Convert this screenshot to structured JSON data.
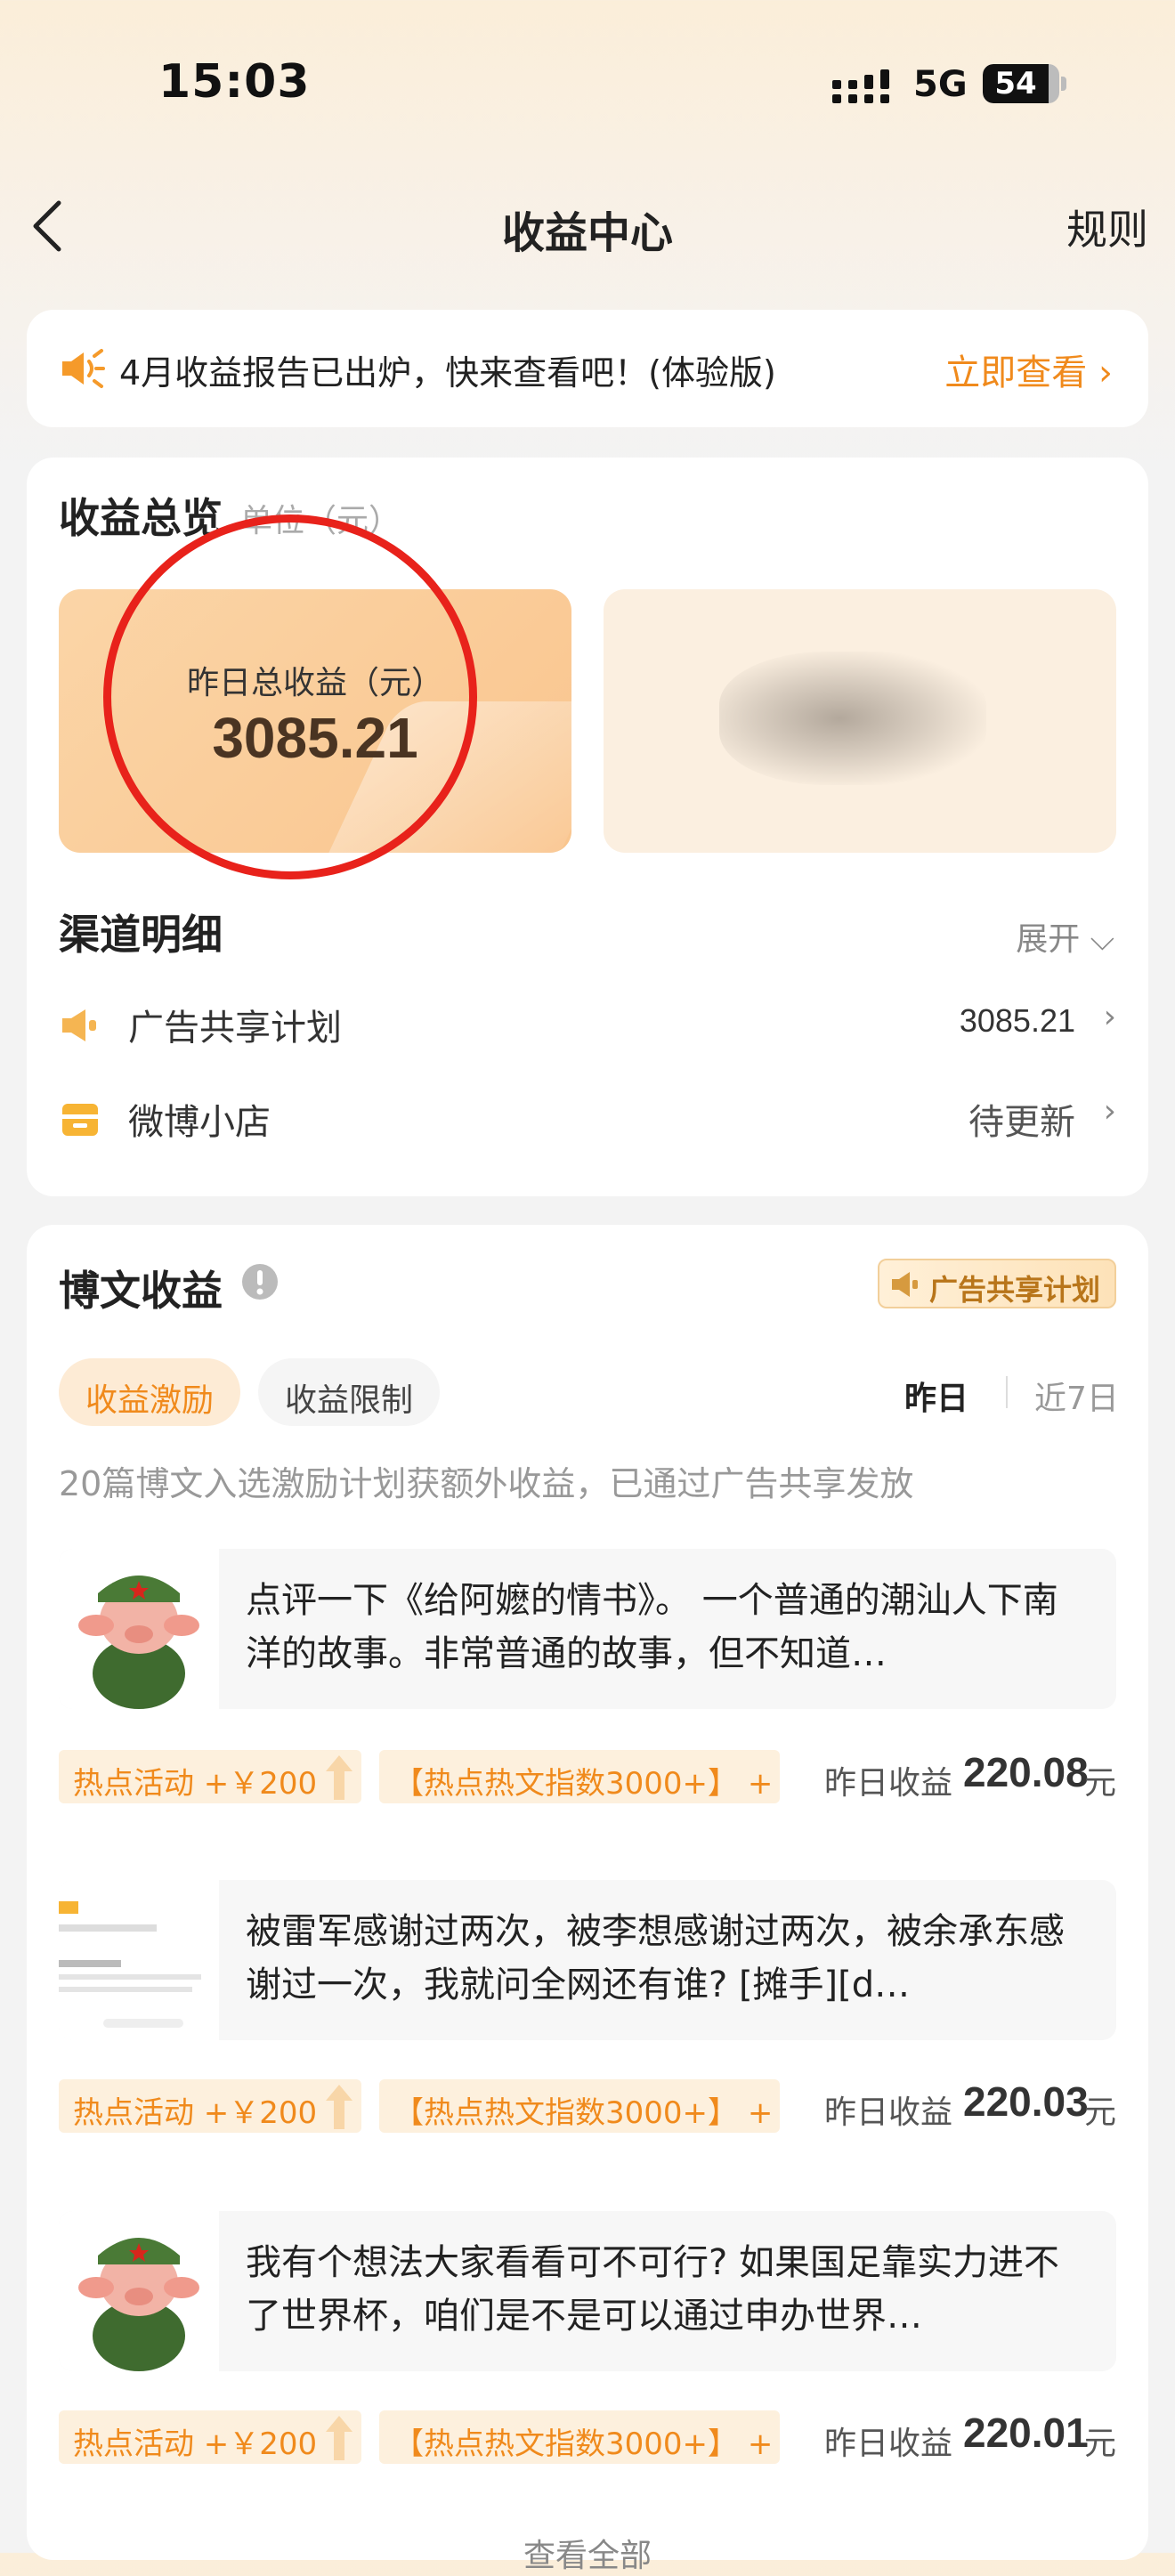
{
  "status_bar": {
    "time": "15:03",
    "network": "5G",
    "battery": "54"
  },
  "nav": {
    "title": "收益中心",
    "rules": "规则"
  },
  "banner": {
    "text": "4月收益报告已出炉，快来查看吧！(体验版)",
    "link": "立即查看"
  },
  "overview": {
    "title": "收益总览",
    "unit": "单位（元）",
    "yesterday_label": "昨日总收益（元）",
    "yesterday_value": "3085.21"
  },
  "channels": {
    "title": "渠道明细",
    "expand": "展开",
    "items": [
      {
        "label": "广告共享计划",
        "value": "3085.21",
        "icon": "megaphone-icon"
      },
      {
        "label": "微博小店",
        "value": "待更新",
        "icon": "shop-icon"
      }
    ]
  },
  "posts_section": {
    "title": "博文收益",
    "badge": "广告共享计划",
    "tabs": [
      "收益激励",
      "收益限制"
    ],
    "periods": [
      "昨日",
      "近7日"
    ],
    "note": "20篇博文入选激励计划获额外收益，已通过广告共享发放",
    "posts": [
      {
        "text": "点评一下《给阿嬷的情书》。 一个普通的潮汕人下南洋的故事。非常普通的故事，但不知道…",
        "tag1": "热点活动 +￥200",
        "tag2": "【热点热文指数3000+】 +",
        "earn_label": "昨日收益",
        "earn_value": "220.08",
        "earn_unit": "元",
        "thumb": "pig-avatar"
      },
      {
        "text": "被雷军感谢过两次，被李想感谢过两次，被余承东感谢过一次，我就问全网还有谁? [摊手][d…",
        "tag1": "热点活动 +￥200",
        "tag2": "【热点热文指数3000+】 +",
        "earn_label": "昨日收益",
        "earn_value": "220.03",
        "earn_unit": "元",
        "thumb": "screenshot-thumb"
      },
      {
        "text": "我有个想法大家看看可不可行? 如果国足靠实力进不了世界杯，咱们是不是可以通过申办世界…",
        "tag1": "热点活动 +￥200",
        "tag2": "【热点热文指数3000+】 +",
        "earn_label": "昨日收益",
        "earn_value": "220.01",
        "earn_unit": "元",
        "thumb": "pig-avatar"
      }
    ],
    "more": "查看全部"
  },
  "colors": {
    "accent": "#f08a1c",
    "annotation": "#e8221b",
    "tile": "#f9c58e"
  }
}
